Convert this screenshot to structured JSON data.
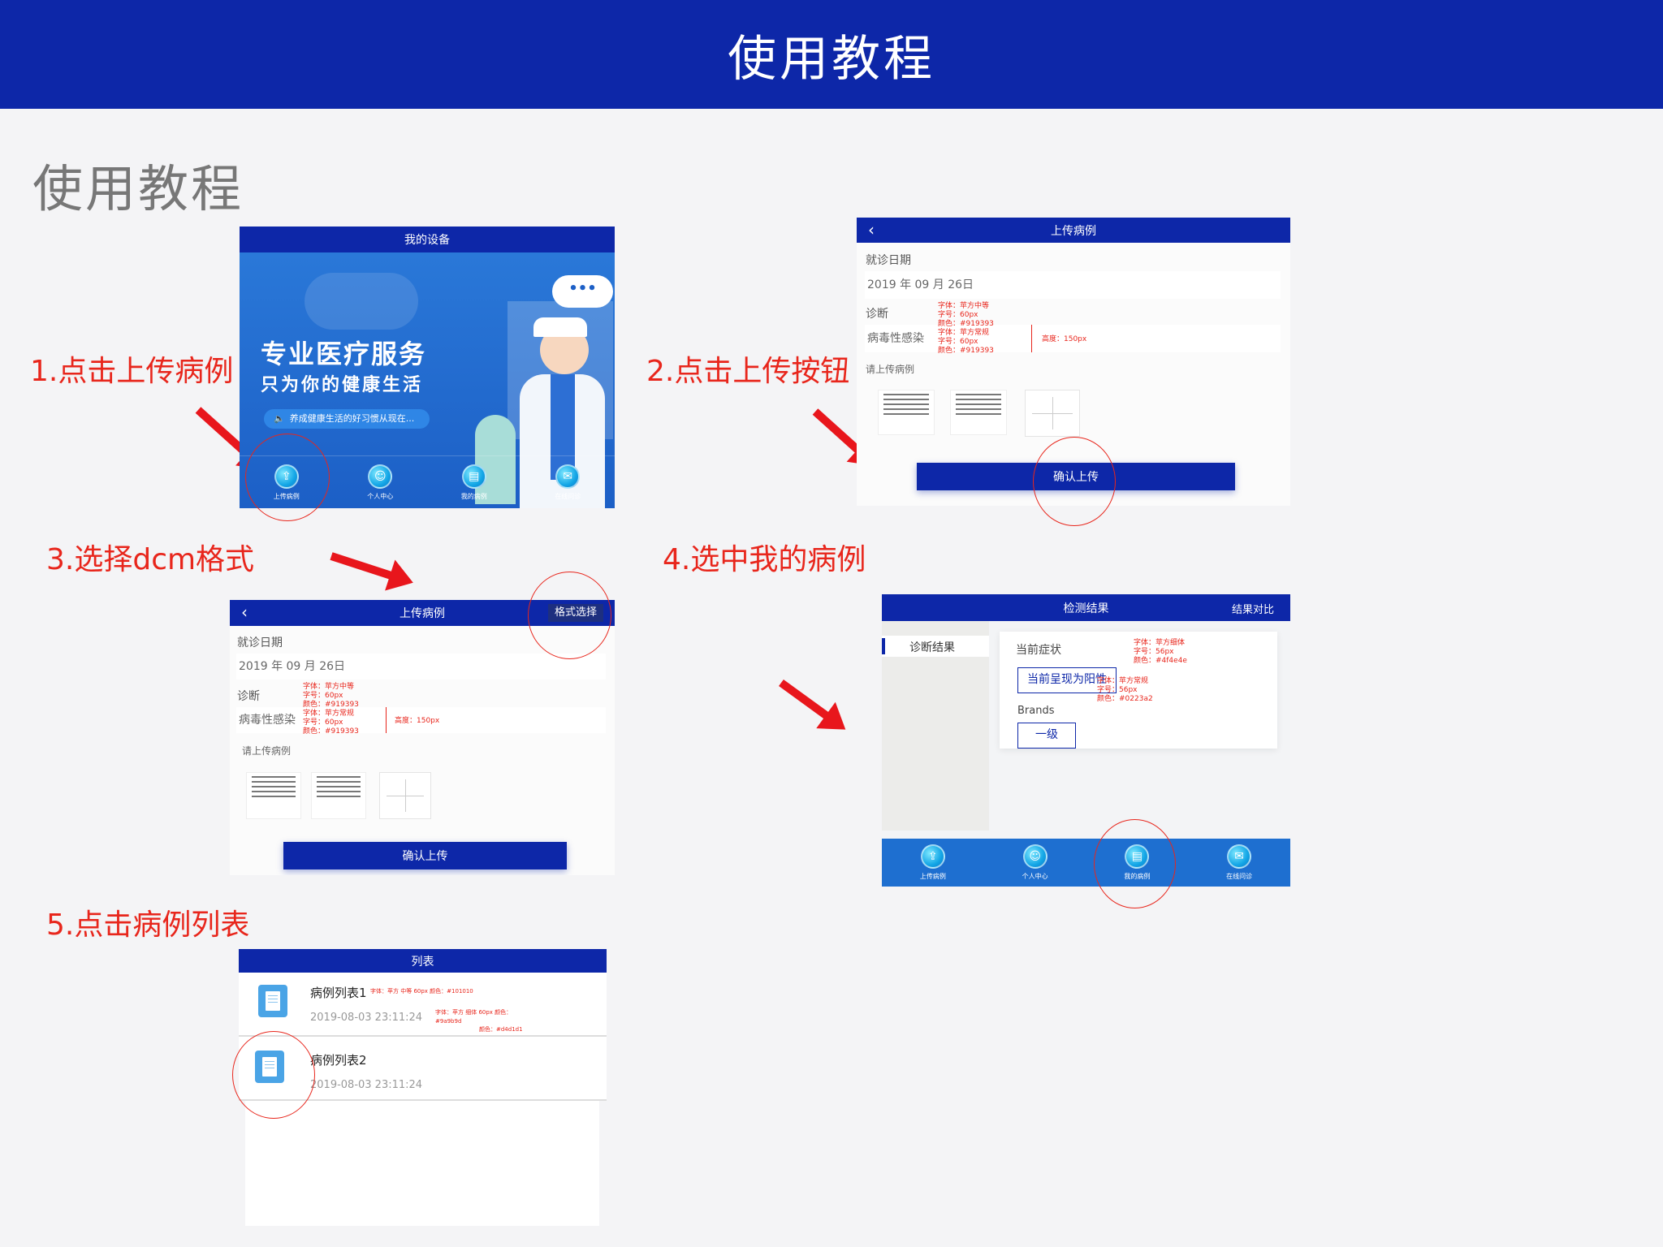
{
  "header": {
    "title": "使用教程"
  },
  "page_title": "使用教程",
  "steps": {
    "s1": "1.点击上传病例",
    "s2": "2.点击上传按钮",
    "s3": "3.选择dcm格式",
    "s4": "4.选中我的病例",
    "s5": "5.点击病例列表"
  },
  "screen1": {
    "nav_title": "我的设备",
    "slogan1": "专业医疗服务",
    "slogan2": "只为你的健康生活",
    "notice": "养成健康生活的好习惯从现在...",
    "tabs": [
      "上传病例",
      "个人中心",
      "我的病例",
      "在线问诊"
    ]
  },
  "upload_form": {
    "nav_title": "上传病例",
    "visit_date_label": "就诊日期",
    "visit_date_value": "2019 年 09 月 26日",
    "diagnosis_label": "诊断",
    "diagnosis_value": "病毒性感染",
    "upload_label": "请上传病例",
    "confirm_button": "确认上传",
    "note1": [
      "字体：苹方中等",
      "字号：60px",
      "颜色：#919393"
    ],
    "note2": [
      "字体：苹方常规",
      "字号：60px",
      "颜色：#919393"
    ],
    "note_height": "高度：150px"
  },
  "screen3": {
    "format_button": "格式选择"
  },
  "screen4": {
    "nav_title": "检测结果",
    "nav_right": "结果对比",
    "sidebar_item": "诊断结果",
    "symptom_label": "当前症状",
    "symptom_value": "当前呈现为阳性",
    "brands_label": "Brands",
    "brands_value": "一级",
    "note1": [
      "字体：苹方细体",
      "字号：56px",
      "颜色：#4f4e4e"
    ],
    "note2": [
      "字体：苹方常规",
      "字号：56px",
      "颜色：#0223a2"
    ],
    "tabs": [
      "上传病例",
      "个人中心",
      "我的病例",
      "在线问诊"
    ]
  },
  "screen5": {
    "nav_title": "列表",
    "items": [
      {
        "title": "病例列表1",
        "time": "2019-08-03 23:11:24"
      },
      {
        "title": "病例列表2",
        "time": "2019-08-03 23:11:24"
      }
    ],
    "note1": "字体：苹方 中等 60px 颜色：#101010",
    "note2": "字体：苹方 细体 60px 颜色：#9a9b9d",
    "note3": "颜色：#d4d1d1"
  },
  "colors": {
    "brand": "#0d27a8",
    "annotation": "#e8261c",
    "background": "#f4f4f6"
  },
  "icons": {
    "back": "chevron-left-icon",
    "doc": "document-icon",
    "plus": "plus-icon"
  }
}
